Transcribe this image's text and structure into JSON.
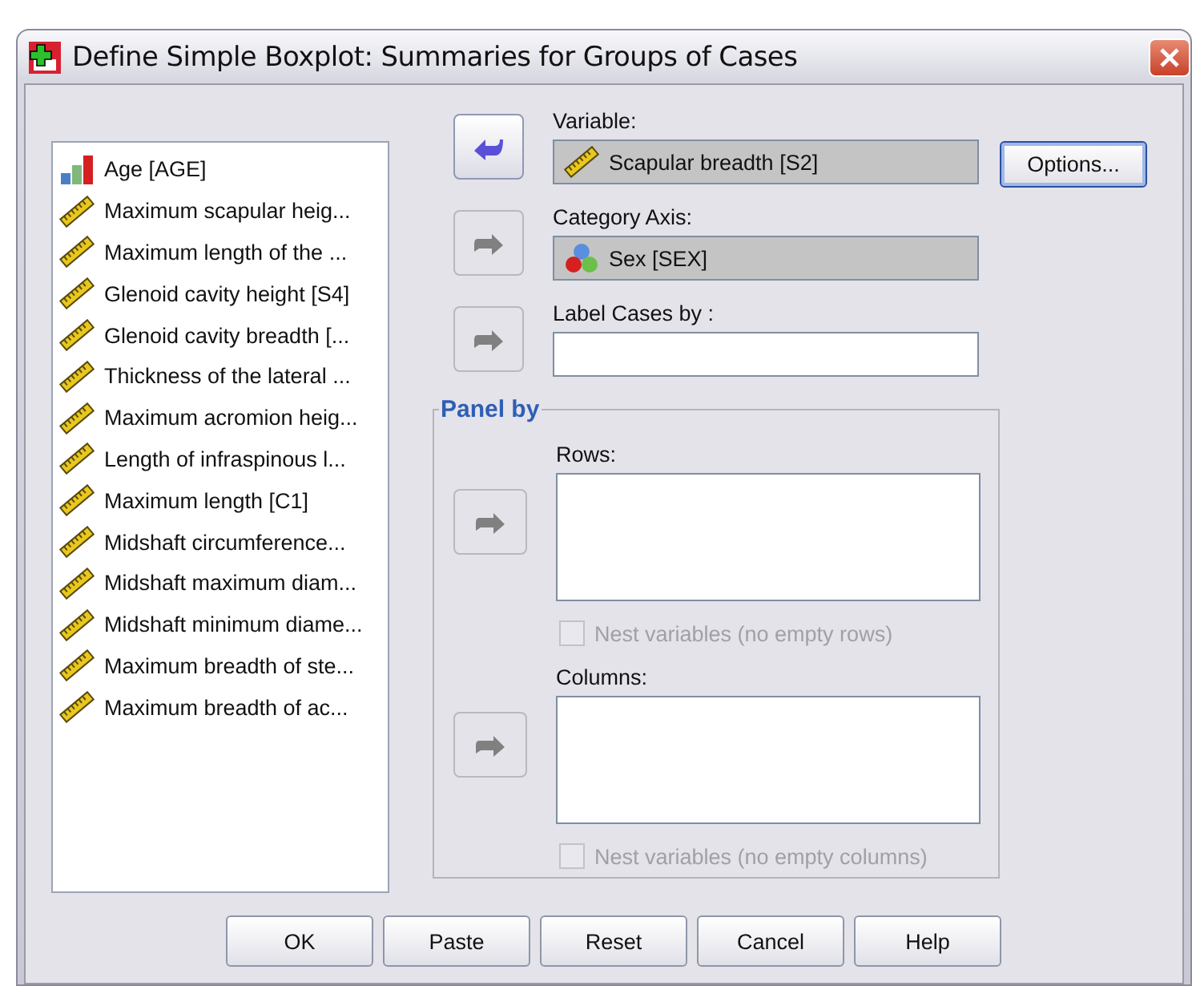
{
  "window": {
    "title": "Define Simple Boxplot: Summaries for Groups of Cases"
  },
  "variable_list": {
    "items": [
      {
        "label": "Age [AGE]",
        "kind": "ordinal"
      },
      {
        "label": "Maximum scapular heig...",
        "kind": "scale"
      },
      {
        "label": "Maximum length of the ...",
        "kind": "scale"
      },
      {
        "label": "Glenoid cavity height [S4]",
        "kind": "scale"
      },
      {
        "label": "Glenoid cavity breadth [...",
        "kind": "scale"
      },
      {
        "label": "Thickness of the lateral ...",
        "kind": "scale"
      },
      {
        "label": "Maximum acromion heig...",
        "kind": "scale"
      },
      {
        "label": "Length of infraspinous l...",
        "kind": "scale"
      },
      {
        "label": "Maximum length [C1]",
        "kind": "scale"
      },
      {
        "label": "Midshaft circumference...",
        "kind": "scale"
      },
      {
        "label": "Midshaft maximum diam...",
        "kind": "scale"
      },
      {
        "label": "Midshaft minimum diame...",
        "kind": "scale"
      },
      {
        "label": "Maximum breadth of ste...",
        "kind": "scale"
      },
      {
        "label": "Maximum breadth of ac...",
        "kind": "scale"
      }
    ]
  },
  "targets": [
    {
      "label": "Variable:",
      "value": "Scapular breadth [S2]",
      "kind": "scale",
      "arrow_reversed": true,
      "arrow_disabled": false
    },
    {
      "label": "Category Axis:",
      "value": "Sex [SEX]",
      "kind": "nominal",
      "arrow_reversed": false,
      "arrow_disabled": true
    },
    {
      "label": "Label Cases by :",
      "arrow_reversed": false,
      "arrow_disabled": true
    }
  ],
  "panel_by": {
    "title": "Panel by",
    "sections": [
      {
        "label": "Rows:",
        "arrow_reversed": false,
        "arrow_disabled": true,
        "checkbox": {
          "label": "Nest variables (no empty rows)",
          "checked": false,
          "disabled": true
        }
      },
      {
        "label": "Columns:",
        "arrow_reversed": false,
        "arrow_disabled": true,
        "checkbox": {
          "label": "Nest variables (no empty columns)",
          "checked": false,
          "disabled": true
        }
      }
    ]
  },
  "options_button": "Options...",
  "buttons": [
    "OK",
    "Paste",
    "Reset",
    "Cancel",
    "Help"
  ]
}
